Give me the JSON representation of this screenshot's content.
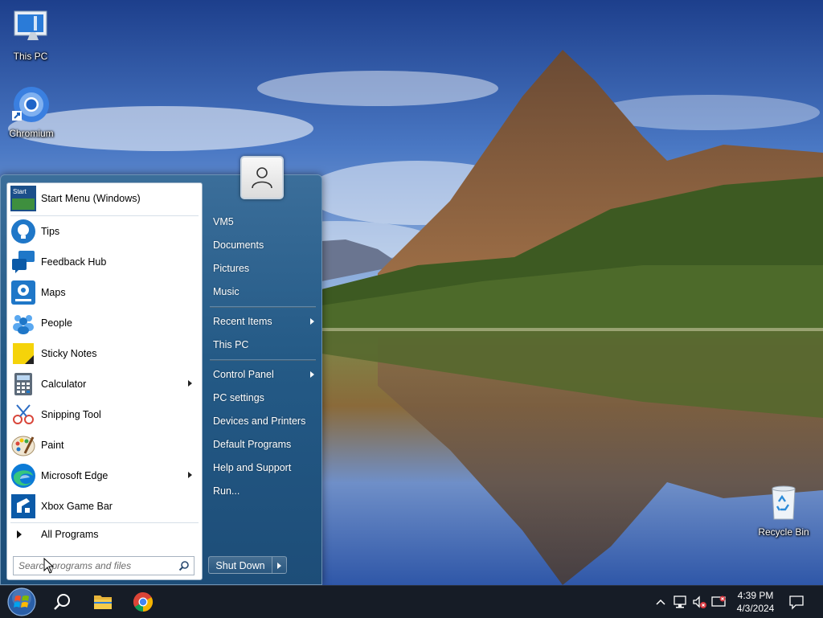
{
  "desktop": {
    "icons": [
      {
        "label": "This PC",
        "icon": "computer-icon"
      },
      {
        "label": "Chromium",
        "icon": "chromium-icon"
      },
      {
        "label": "Recycle Bin",
        "icon": "recycle-bin-icon"
      }
    ]
  },
  "start_menu": {
    "pinned": {
      "label": "Start Menu (Windows)",
      "icon": "start-menu-app-icon"
    },
    "items": [
      {
        "label": "Tips",
        "icon": "tips-icon",
        "has_submenu": false
      },
      {
        "label": "Feedback Hub",
        "icon": "feedback-hub-icon",
        "has_submenu": false
      },
      {
        "label": "Maps",
        "icon": "maps-icon",
        "has_submenu": false
      },
      {
        "label": "People",
        "icon": "people-icon",
        "has_submenu": false
      },
      {
        "label": "Sticky Notes",
        "icon": "sticky-notes-icon",
        "has_submenu": false
      },
      {
        "label": "Calculator",
        "icon": "calculator-icon",
        "has_submenu": true
      },
      {
        "label": "Snipping Tool",
        "icon": "snipping-tool-icon",
        "has_submenu": false
      },
      {
        "label": "Paint",
        "icon": "paint-icon",
        "has_submenu": false
      },
      {
        "label": "Microsoft Edge",
        "icon": "edge-icon",
        "has_submenu": true
      },
      {
        "label": "Xbox Game Bar",
        "icon": "xbox-game-bar-icon",
        "has_submenu": false
      }
    ],
    "all_programs_label": "All Programs",
    "search_placeholder": "Search programs and files",
    "right_items": [
      {
        "label": "VM5",
        "has_submenu": false
      },
      {
        "label": "Documents",
        "has_submenu": false
      },
      {
        "label": "Pictures",
        "has_submenu": false
      },
      {
        "label": "Music",
        "has_submenu": false
      },
      {
        "label": "Recent Items",
        "has_submenu": true
      },
      {
        "label": "This PC",
        "has_submenu": false
      },
      {
        "label": "Control Panel",
        "has_submenu": true
      },
      {
        "label": "PC settings",
        "has_submenu": false
      },
      {
        "label": "Devices and Printers",
        "has_submenu": false
      },
      {
        "label": "Default Programs",
        "has_submenu": false
      },
      {
        "label": "Help and Support",
        "has_submenu": false
      },
      {
        "label": "Run...",
        "has_submenu": false
      }
    ],
    "shutdown_label": "Shut Down"
  },
  "taskbar": {
    "time": "4:39 PM",
    "date": "4/3/2024",
    "pinned": [
      "start-orb-icon",
      "search-icon",
      "file-explorer-icon",
      "chrome-icon"
    ],
    "tray": [
      "chevron-up-icon",
      "network-icon",
      "volume-muted-icon",
      "display-icon",
      "notification-icon"
    ]
  },
  "colors": {
    "menu_blue": "#245a86",
    "taskbar": "#161c26",
    "accent": "#1f77c8"
  }
}
